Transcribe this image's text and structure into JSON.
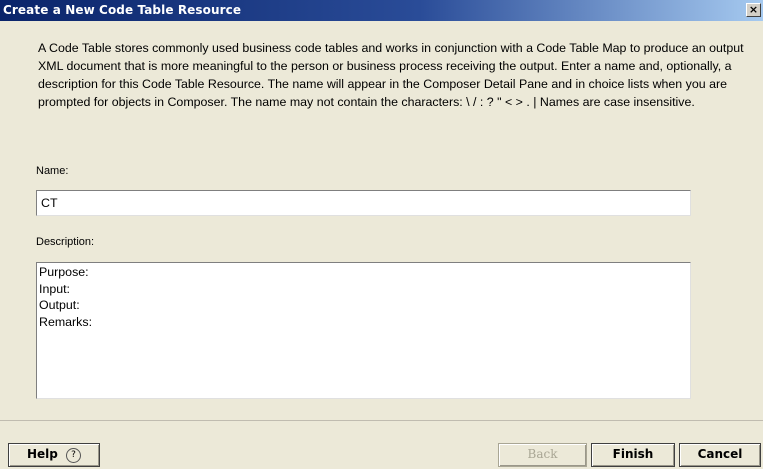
{
  "window": {
    "title": "Create a New Code Table Resource",
    "close_glyph": "×"
  },
  "intro_text": "A Code Table stores commonly used business code tables and works in conjunction with a Code Table Map to produce an output XML document that is more meaningful to the person or business process receiving the output.  Enter a name and, optionally, a description for this Code Table Resource.  The name will appear in the Composer Detail Pane and in choice lists when you are prompted for objects in Composer.  The name may not contain the characters: \\ / : ? \" < > . |  Names are case insensitive.",
  "form": {
    "name_label": "Name:",
    "name_value": "CT",
    "description_label": "Description:",
    "description_value": "Purpose:\nInput:\nOutput:\nRemarks:"
  },
  "buttons": {
    "help_label": "Help",
    "help_icon": "?",
    "back_label": "Back",
    "finish_label": "Finish",
    "cancel_label": "Cancel"
  }
}
